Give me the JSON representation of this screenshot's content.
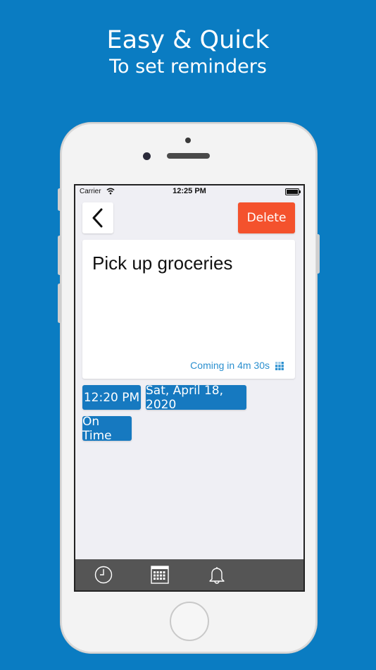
{
  "headline": {
    "title": "Easy & Quick",
    "subtitle": "To set reminders"
  },
  "status_bar": {
    "carrier": "Carrier",
    "time": "12:25 PM"
  },
  "toolbar": {
    "back_icon": "chevron-left-icon",
    "delete_label": "Delete"
  },
  "reminder": {
    "title": "Pick up groceries",
    "countdown": "Coming in 4m 30s"
  },
  "chips": {
    "time": "12:20 PM",
    "date": "Sat, April 18, 2020",
    "status": "On Time"
  },
  "tabbar": {
    "items": [
      "clock-icon",
      "calendar-icon",
      "bell-icon"
    ]
  },
  "colors": {
    "background": "#0a7cc2",
    "accent": "#1679c0",
    "delete": "#f4522d",
    "countdown_text": "#2a8fcf",
    "tabbar": "#555555"
  }
}
